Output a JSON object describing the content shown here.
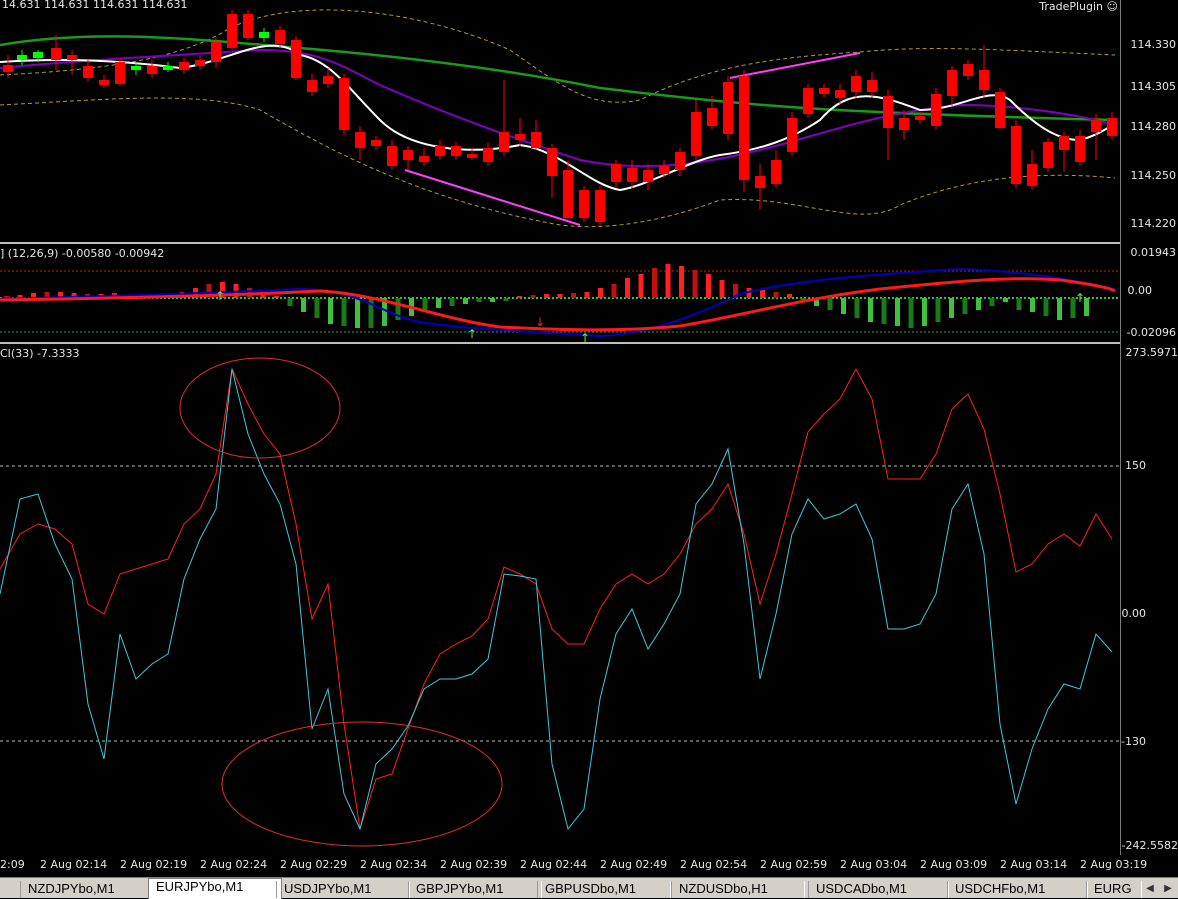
{
  "price_header": "14.631 114.631 114.631 114.631",
  "trade_plugin": {
    "label": "TradePlugin",
    "icon": "smiley-icon"
  },
  "price_axis": [
    "114.330",
    "114.305",
    "114.280",
    "114.250",
    "114.220"
  ],
  "macd": {
    "header": "] (12,26,9) -0.00580 -0.00942",
    "axis": [
      "0.01943",
      "0.00",
      "-0.02096"
    ]
  },
  "cci": {
    "header": "CI(33) -7.3333",
    "axis": [
      "273.5971",
      "150",
      "0.00",
      "-130",
      "-242.5582"
    ]
  },
  "time_ticks": [
    "2:09",
    "2 Aug 02:14",
    "2 Aug 02:19",
    "2 Aug 02:24",
    "2 Aug 02:29",
    "2 Aug 02:34",
    "2 Aug 02:39",
    "2 Aug 02:44",
    "2 Aug 02:49",
    "2 Aug 02:54",
    "2 Aug 02:59",
    "2 Aug 03:04",
    "2 Aug 03:09",
    "2 Aug 03:14",
    "2 Aug 03:19"
  ],
  "tabs": [
    "NZDJPYbo,M1",
    "EURJPYbo,M1",
    "USDJPYbo,M1",
    "GBPJPYbo,M1",
    "GBPUSDbo,M1",
    "NZDUSDbo,H1",
    "USDCADbo,M1",
    "USDCHFbo,M1",
    "EURG"
  ],
  "active_tab": "EURJPYbo,M1",
  "colors": {
    "bull": "#00ff00",
    "bear": "#ff0000",
    "sma": "#ffffff",
    "ma_slow": "#1a9a1a",
    "ma_mid": "#8000c0",
    "cci_fast": "#40c8d8",
    "cci_slow": "#ff2020"
  }
}
